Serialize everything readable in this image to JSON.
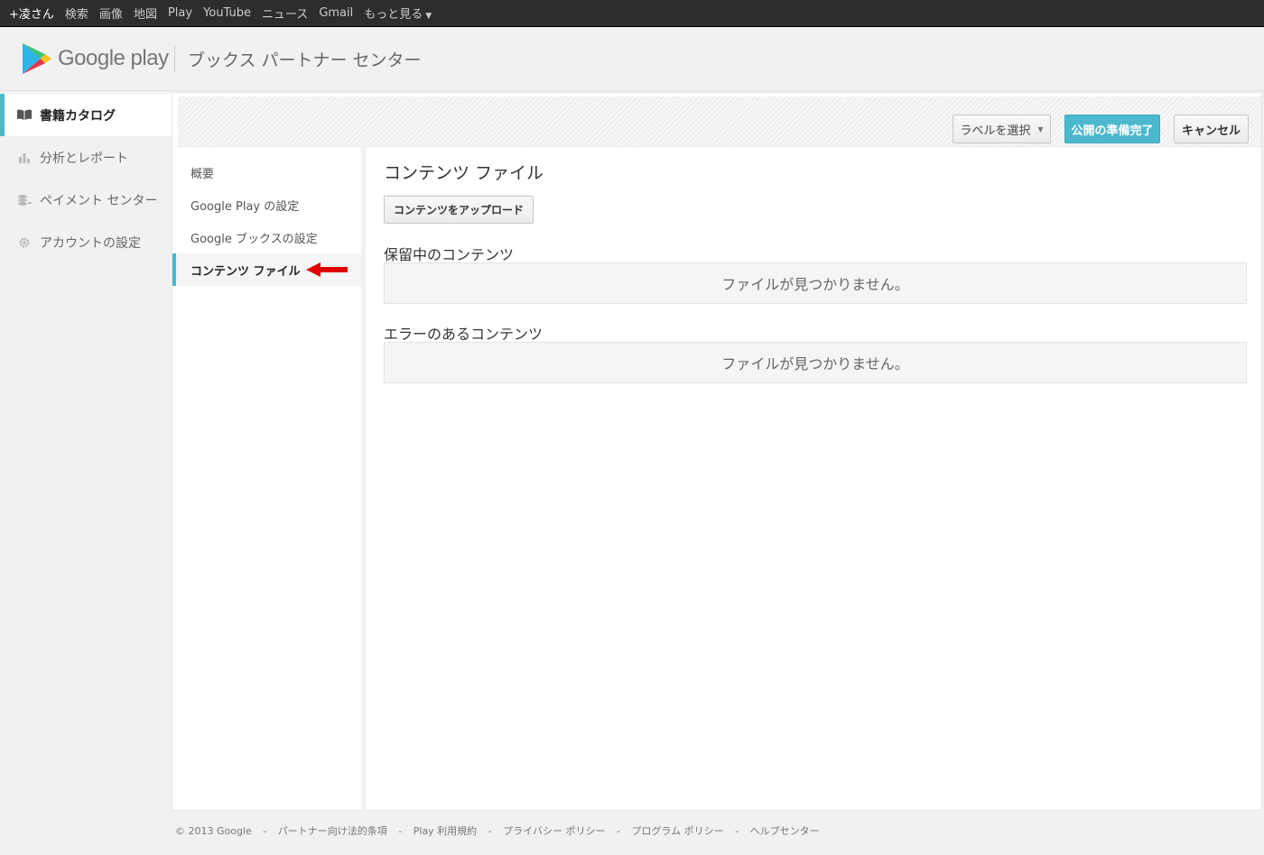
{
  "topbar": {
    "items": [
      "+凌さん",
      "検索",
      "画像",
      "地図",
      "Play",
      "YouTube",
      "ニュース",
      "Gmail"
    ],
    "more": "もっと見る"
  },
  "header": {
    "logo_text": "Google play",
    "title": "ブックス パートナー センター"
  },
  "leftnav": {
    "items": [
      {
        "label": "書籍カタログ",
        "icon": "book-icon",
        "active": true
      },
      {
        "label": "分析とレポート",
        "icon": "bar-chart-icon",
        "active": false
      },
      {
        "label": "ペイメント センター",
        "icon": "coins-icon",
        "active": false
      },
      {
        "label": "アカウントの設定",
        "icon": "gear-icon",
        "active": false
      }
    ]
  },
  "toolbar": {
    "label_button": "ラベルを選択",
    "publish_button": "公開の準備完了",
    "cancel_button": "キャンセル"
  },
  "subnav": {
    "items": [
      {
        "label": "概要",
        "active": false
      },
      {
        "label": "Google Play の設定",
        "active": false
      },
      {
        "label": "Google ブックスの設定",
        "active": false
      },
      {
        "label": "コンテンツ ファイル",
        "active": true
      }
    ]
  },
  "content": {
    "title": "コンテンツ ファイル",
    "upload_button": "コンテンツをアップロード",
    "pending_heading": "保留中のコンテンツ",
    "pending_empty": "ファイルが見つかりません。",
    "error_heading": "エラーのあるコンテンツ",
    "error_empty": "ファイルが見つかりません。"
  },
  "footer": {
    "copyright": "© 2013 Google",
    "links": [
      "パートナー向け法的条項",
      "Play 利用規約",
      "プライバシー ポリシー",
      "プログラム ポリシー",
      "ヘルプセンター"
    ],
    "separator": "-"
  },
  "colors": {
    "accent": "#4bb8cd",
    "topbar": "#2d2d2d",
    "arrow": "#e00000"
  }
}
